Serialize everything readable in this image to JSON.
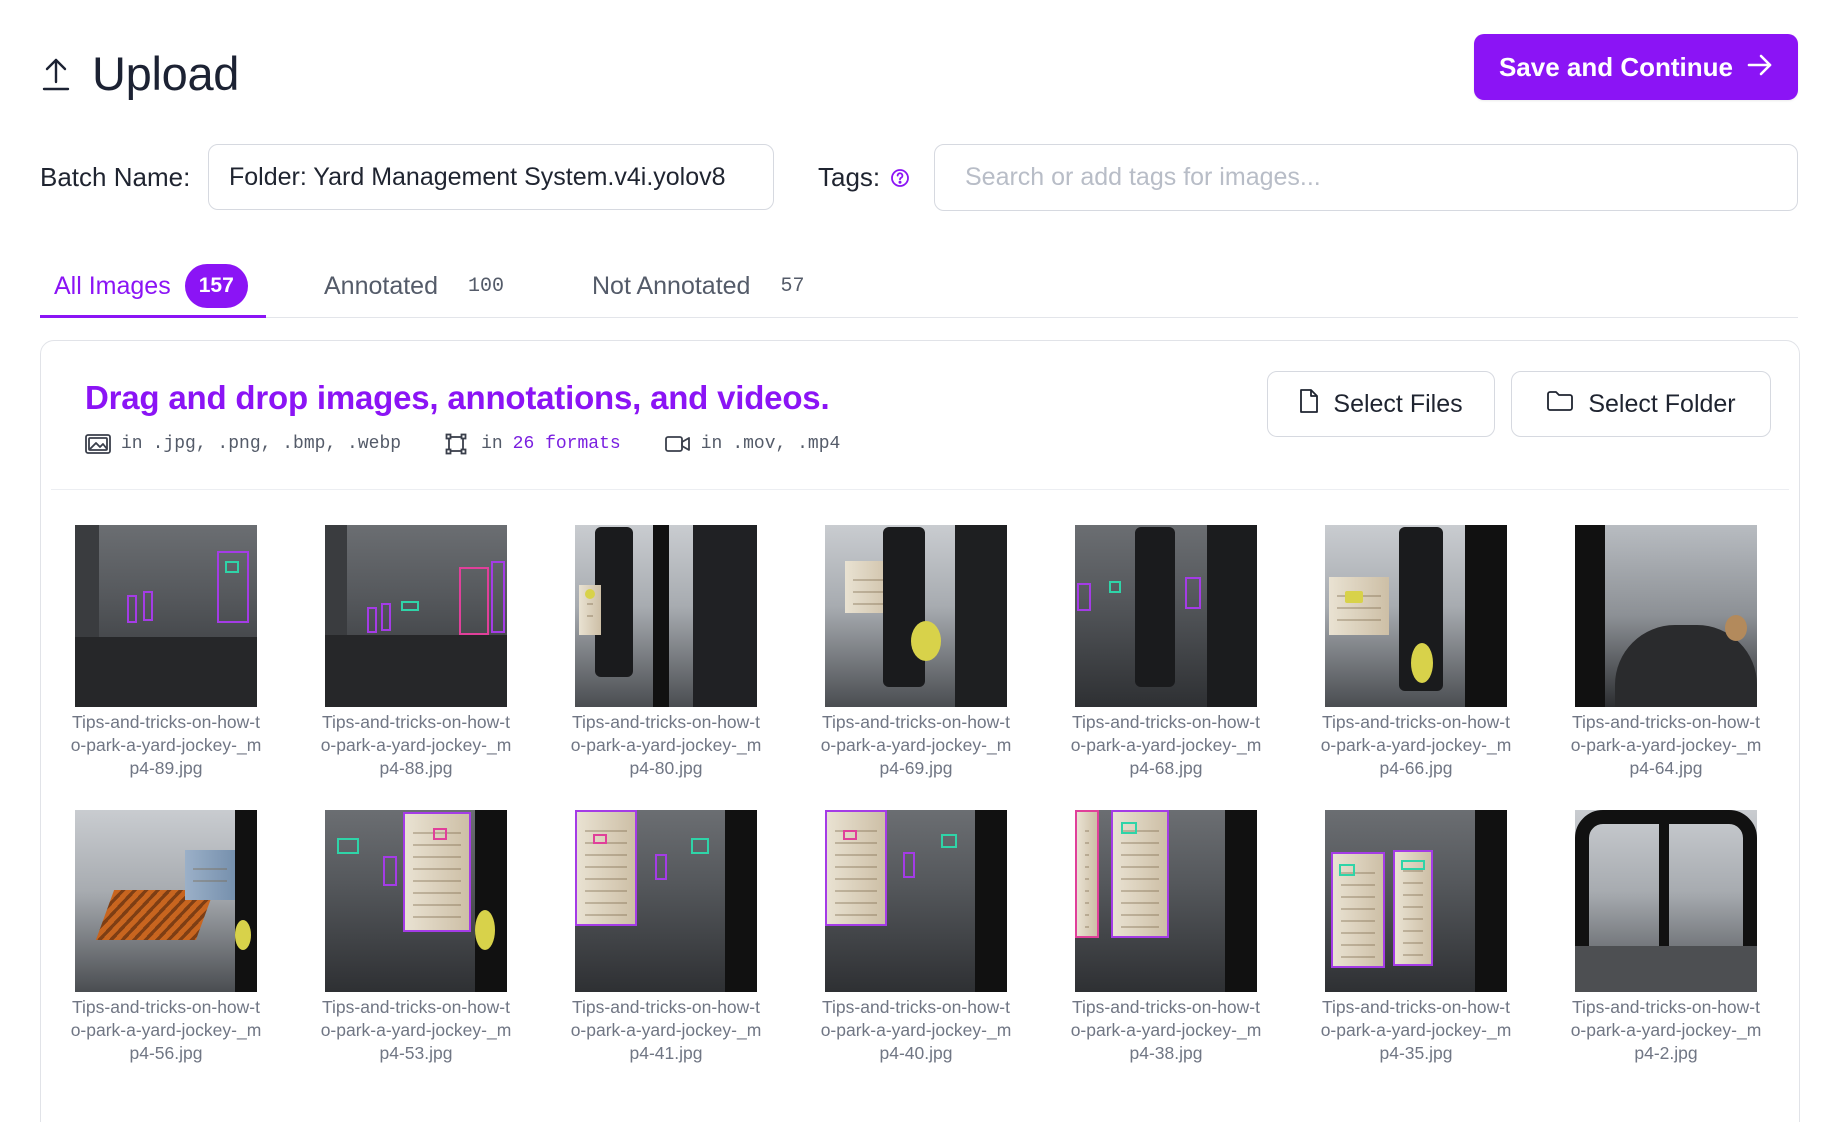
{
  "header": {
    "title": "Upload",
    "icon": "upload-icon",
    "save_label": "Save and Continue",
    "accent_color": "#8b14f5"
  },
  "batch": {
    "label": "Batch Name:",
    "value": "Folder: Yard Management System.v4i.yolov8"
  },
  "tags": {
    "label": "Tags:",
    "placeholder": "Search or add tags for images..."
  },
  "tabs": [
    {
      "label": "All Images",
      "count": "157",
      "active": true
    },
    {
      "label": "Annotated",
      "count": "100",
      "active": false
    },
    {
      "label": "Not Annotated",
      "count": "57",
      "active": false
    }
  ],
  "dropzone": {
    "title": "Drag and drop images, annotations, and videos.",
    "formats": {
      "images_prefix": "in",
      "images": ".jpg, .png, .bmp, .webp",
      "annotations_prefix": "in",
      "annotations": "26 formats",
      "videos_prefix": "in",
      "videos": ".mov, .mp4"
    },
    "select_files": "Select Files",
    "select_folder": "Select Folder"
  },
  "images": [
    {
      "name": "Tips-and-tricks-on-how-to-park-a-yard-jockey-_mp4-89.jpg",
      "scene": "dark-aisle"
    },
    {
      "name": "Tips-and-tricks-on-how-to-park-a-yard-jockey-_mp4-88.jpg",
      "scene": "dark-aisle"
    },
    {
      "name": "Tips-and-tricks-on-how-to-park-a-yard-jockey-_mp4-80.jpg",
      "scene": "cab"
    },
    {
      "name": "Tips-and-tricks-on-how-to-park-a-yard-jockey-_mp4-69.jpg",
      "scene": "cab"
    },
    {
      "name": "Tips-and-tricks-on-how-to-park-a-yard-jockey-_mp4-68.jpg",
      "scene": "cab-boxes"
    },
    {
      "name": "Tips-and-tricks-on-how-to-park-a-yard-jockey-_mp4-66.jpg",
      "scene": "cab"
    },
    {
      "name": "Tips-and-tricks-on-how-to-park-a-yard-jockey-_mp4-64.jpg",
      "scene": "wheel"
    },
    {
      "name": "Tips-and-tricks-on-how-to-park-a-yard-jockey-_mp4-56.jpg",
      "scene": "chassis"
    },
    {
      "name": "Tips-and-tricks-on-how-to-park-a-yard-jockey-_mp4-53.jpg",
      "scene": "trailer"
    },
    {
      "name": "Tips-and-tricks-on-how-to-park-a-yard-jockey-_mp4-41.jpg",
      "scene": "trailer"
    },
    {
      "name": "Tips-and-tricks-on-how-to-park-a-yard-jockey-_mp4-40.jpg",
      "scene": "trailer"
    },
    {
      "name": "Tips-and-tricks-on-how-to-park-a-yard-jockey-_mp4-38.jpg",
      "scene": "trailer2"
    },
    {
      "name": "Tips-and-tricks-on-how-to-park-a-yard-jockey-_mp4-35.jpg",
      "scene": "trailer2"
    },
    {
      "name": "Tips-and-tricks-on-how-to-park-a-yard-jockey-_mp4-2.jpg",
      "scene": "window"
    }
  ]
}
